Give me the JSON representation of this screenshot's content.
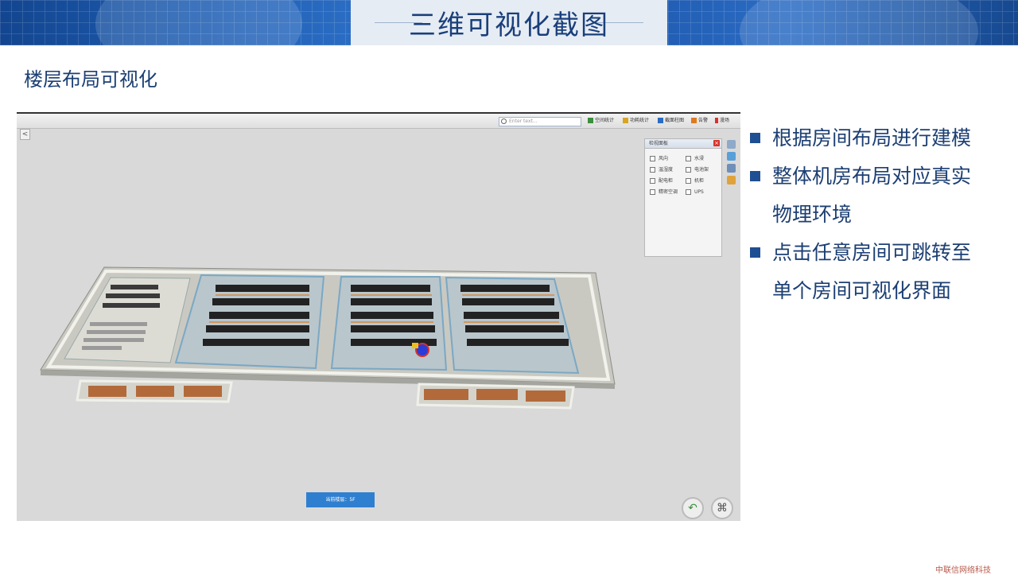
{
  "page": {
    "title": "三维可视化截图",
    "subtitle": "楼层布局可视化",
    "footer": "中联信网络科技"
  },
  "toolbar": {
    "search_placeholder": "Enter text...",
    "items": [
      {
        "label": "空间统计",
        "icon": "grid-icon",
        "color": "#3c8f3c"
      },
      {
        "label": "功耗统计",
        "icon": "bolt-icon",
        "color": "#d9a520"
      },
      {
        "label": "截面柱图",
        "icon": "chart-icon",
        "color": "#2a6cc2"
      },
      {
        "label": "告警",
        "icon": "warning-icon",
        "color": "#e07a1e"
      },
      {
        "label": "漫场",
        "icon": "pin-icon",
        "color": "#d8322c"
      }
    ],
    "back_label": "<"
  },
  "view_panel": {
    "title": "检视面板",
    "close": "×",
    "left_options": [
      "风向",
      "温湿度",
      "配电柜",
      "精密空调"
    ],
    "right_options": [
      "水浸",
      "电池架",
      "机柜",
      "UPS"
    ]
  },
  "floor": {
    "label": "当前楼层：5F"
  },
  "controls": {
    "undo": "↶",
    "walk": "⌘"
  },
  "bullets": [
    {
      "text": "根据房间布局进行建模",
      "continuation": ""
    },
    {
      "text": "整体机房布局对应真实",
      "continuation": "物理环境"
    },
    {
      "text": "点击任意房间可跳转至",
      "continuation": "单个房间可视化界面"
    }
  ],
  "colors": {
    "accent": "#1c3f73",
    "banner": "#1d5cb0",
    "floor_button": "#2f7fd0"
  }
}
